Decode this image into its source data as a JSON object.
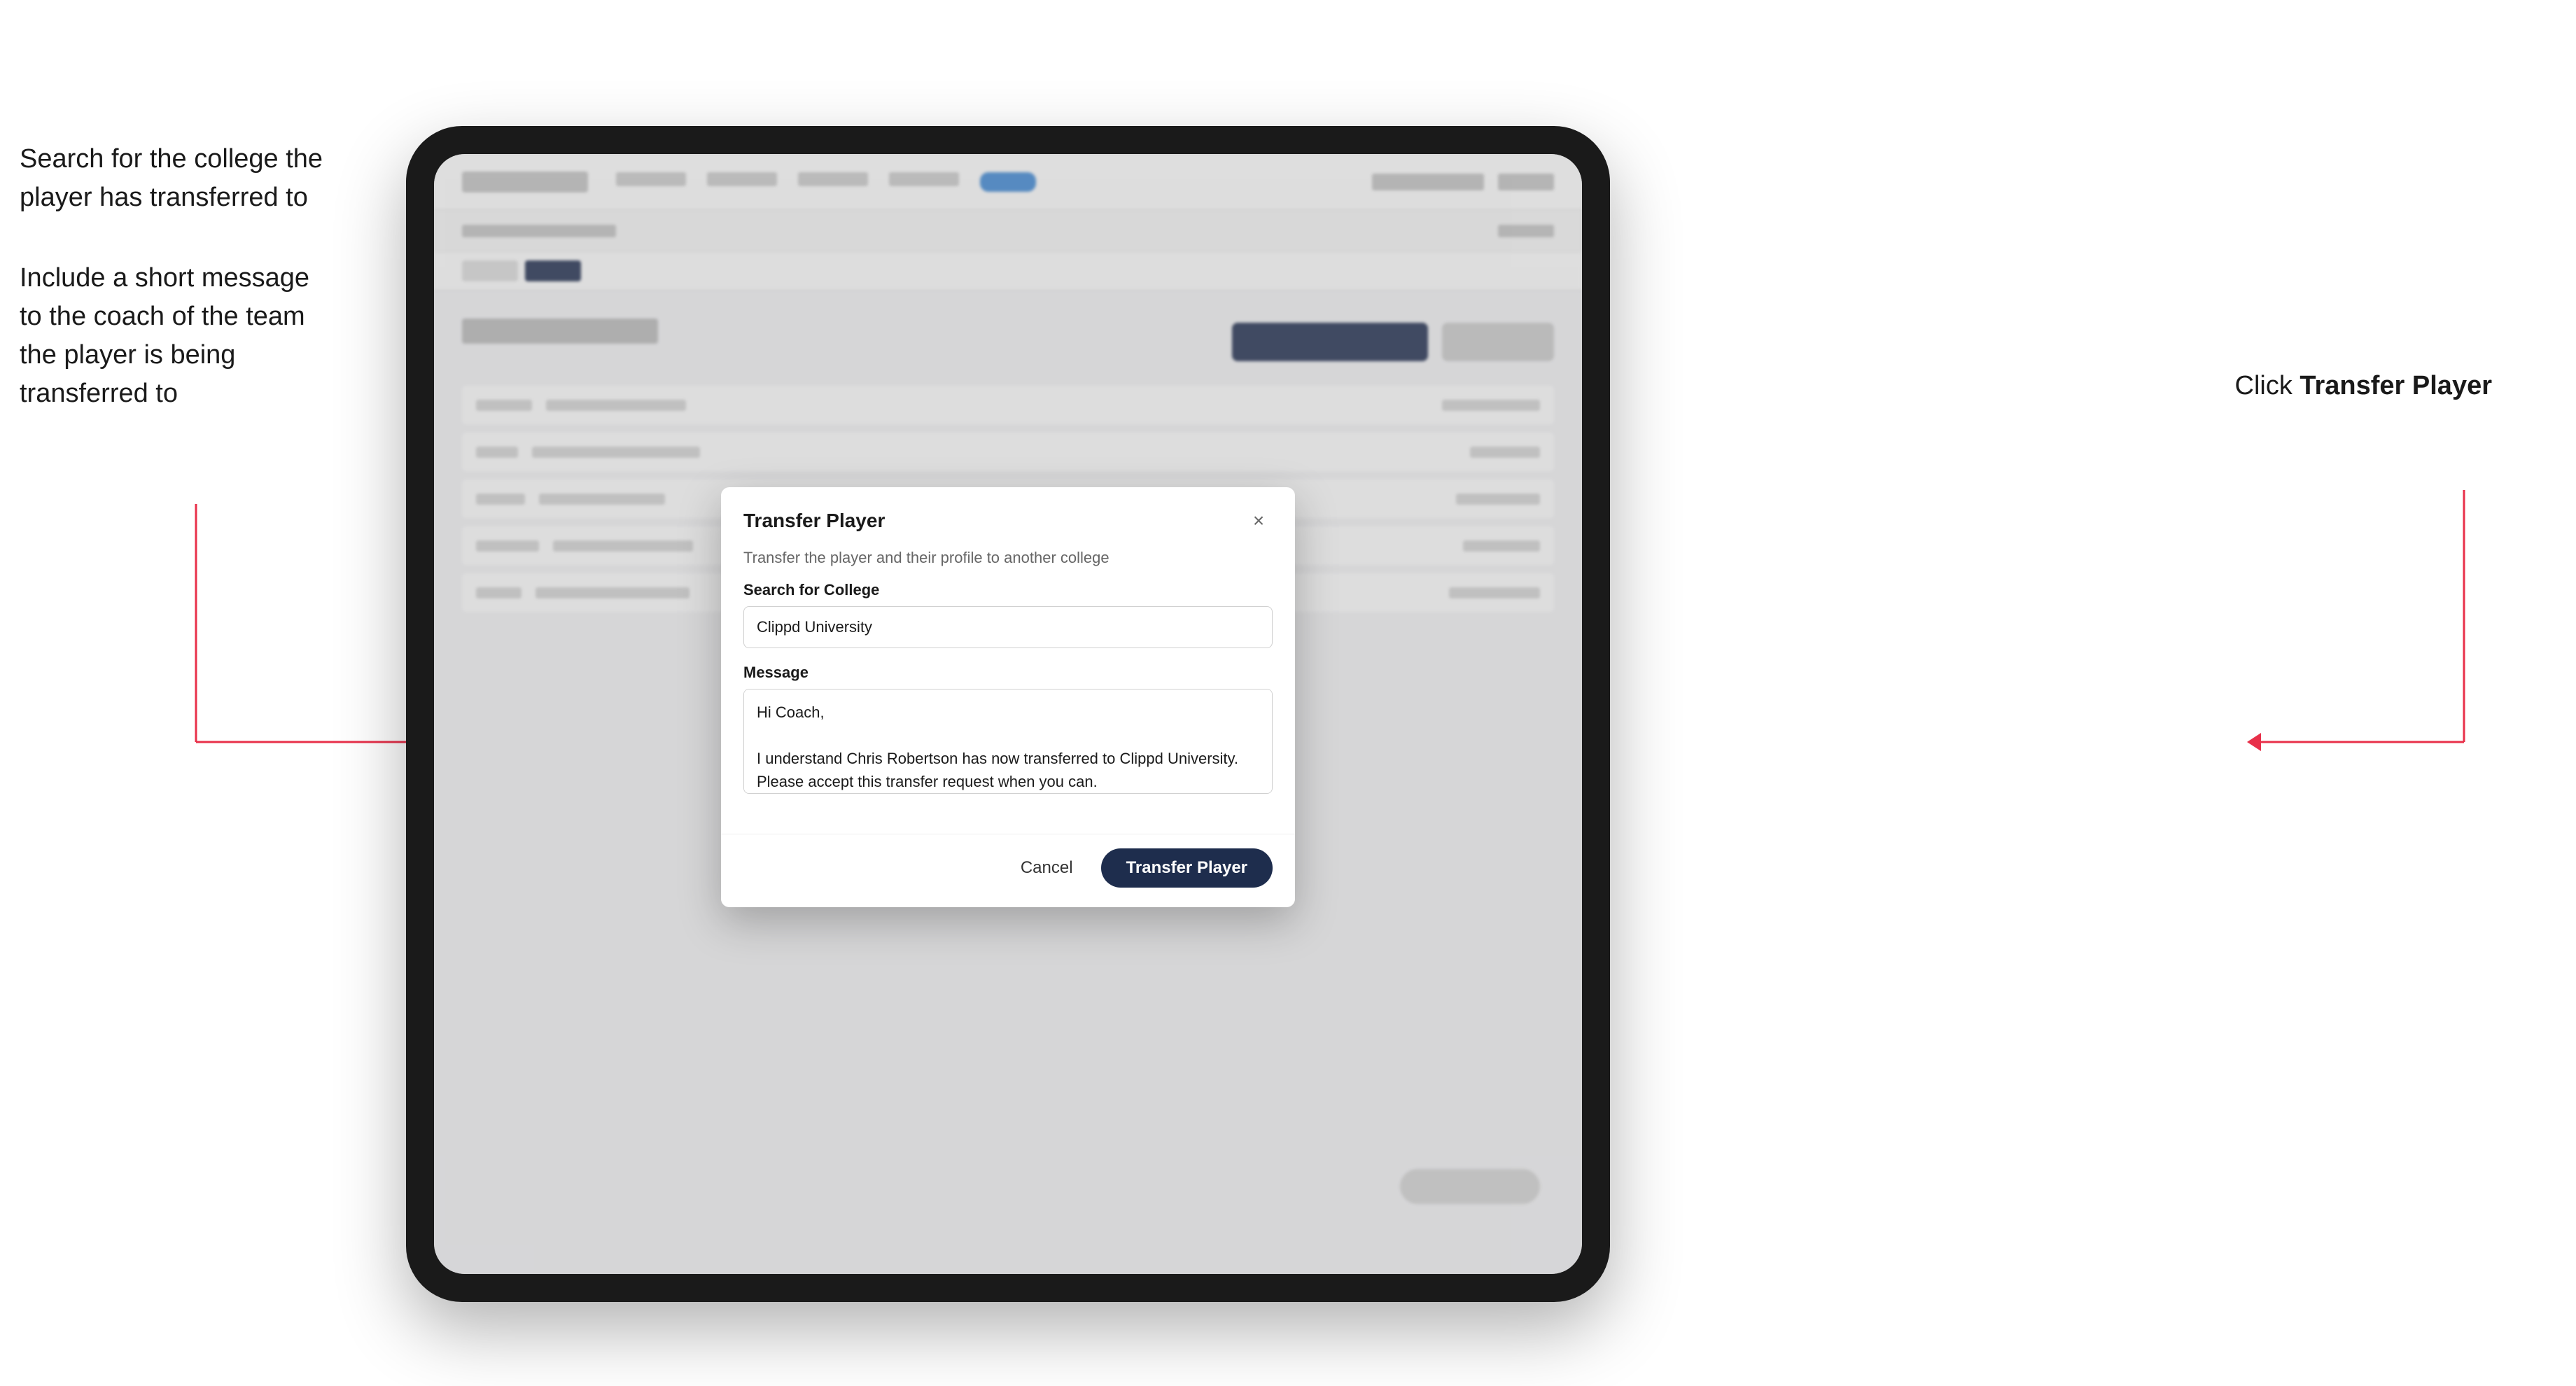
{
  "annotations": {
    "left_line1": "Search for the college the",
    "left_line2": "player has transferred to",
    "left_line3": "Include a short message",
    "left_line4": "to the coach of the team",
    "left_line5": "the player is being",
    "left_line6": "transferred to",
    "right_prefix": "Click ",
    "right_bold": "Transfer Player"
  },
  "modal": {
    "title": "Transfer Player",
    "description": "Transfer the player and their profile to another college",
    "college_label": "Search for College",
    "college_value": "Clippd University",
    "message_label": "Message",
    "message_value": "Hi Coach,\n\nI understand Chris Robertson has now transferred to Clippd University. Please accept this transfer request when you can.",
    "cancel_label": "Cancel",
    "transfer_label": "Transfer Player"
  }
}
